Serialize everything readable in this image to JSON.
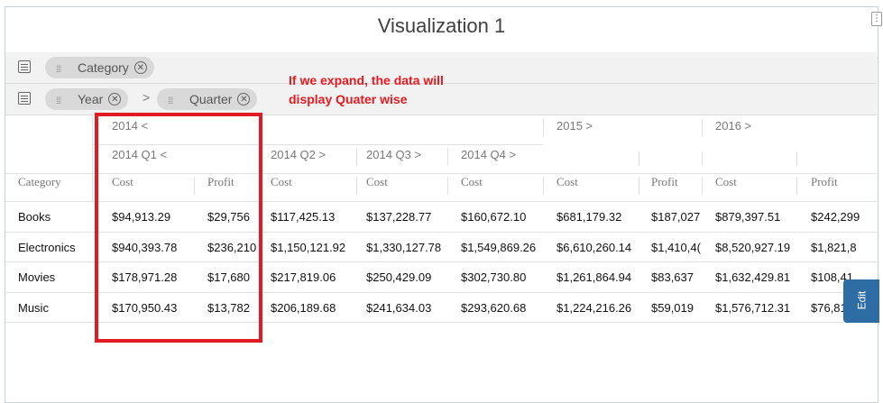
{
  "title": "Visualization 1",
  "annotation": [
    "If we expand, the data will",
    "display Quater wise"
  ],
  "row_shelf": {
    "pill": "Category"
  },
  "col_shelf": {
    "pill1": "Year",
    "pill2": "Quarter",
    "separator": ">"
  },
  "header": {
    "year_2014": "2014 <",
    "year_2015": "2015 >",
    "year_2016": "2016 >",
    "q1": "2014 Q1 <",
    "q2": "2014 Q2 >",
    "q3": "2014 Q3 >",
    "q4": "2014 Q4 >",
    "category": "Category",
    "cost": "Cost",
    "profit": "Profit"
  },
  "rows": [
    {
      "category": "Books",
      "cells": [
        "$94,913.29",
        "$29,756",
        "$117,425.13",
        "$137,228.77",
        "$160,672.10",
        "$681,179.32",
        "$187,027",
        "$879,397.51",
        "$242,299"
      ]
    },
    {
      "category": "Electronics",
      "cells": [
        "$940,393.78",
        "$236,210",
        "$1,150,121.92",
        "$1,330,127.78",
        "$1,549,869.26",
        "$6,610,260.14",
        "$1,410,4(",
        "$8,520,927.19",
        "$1,821,8"
      ]
    },
    {
      "category": "Movies",
      "cells": [
        "$178,971.28",
        "$17,680",
        "$217,819.06",
        "$250,429.09",
        "$302,730.80",
        "$1,261,864.94",
        "$83,637",
        "$1,632,429.81",
        "$108,41"
      ]
    },
    {
      "category": "Music",
      "cells": [
        "$170,950.43",
        "$13,782",
        "$206,189.68",
        "$241,634.03",
        "$293,620.68",
        "$1,224,216.26",
        "$59,019",
        "$1,576,712.31",
        "$76,81"
      ]
    }
  ],
  "edit_label": "Edit",
  "colors": {
    "annotation": "#e8191f",
    "redbox": "#e01b24",
    "edit_tab": "#2e6da4"
  }
}
